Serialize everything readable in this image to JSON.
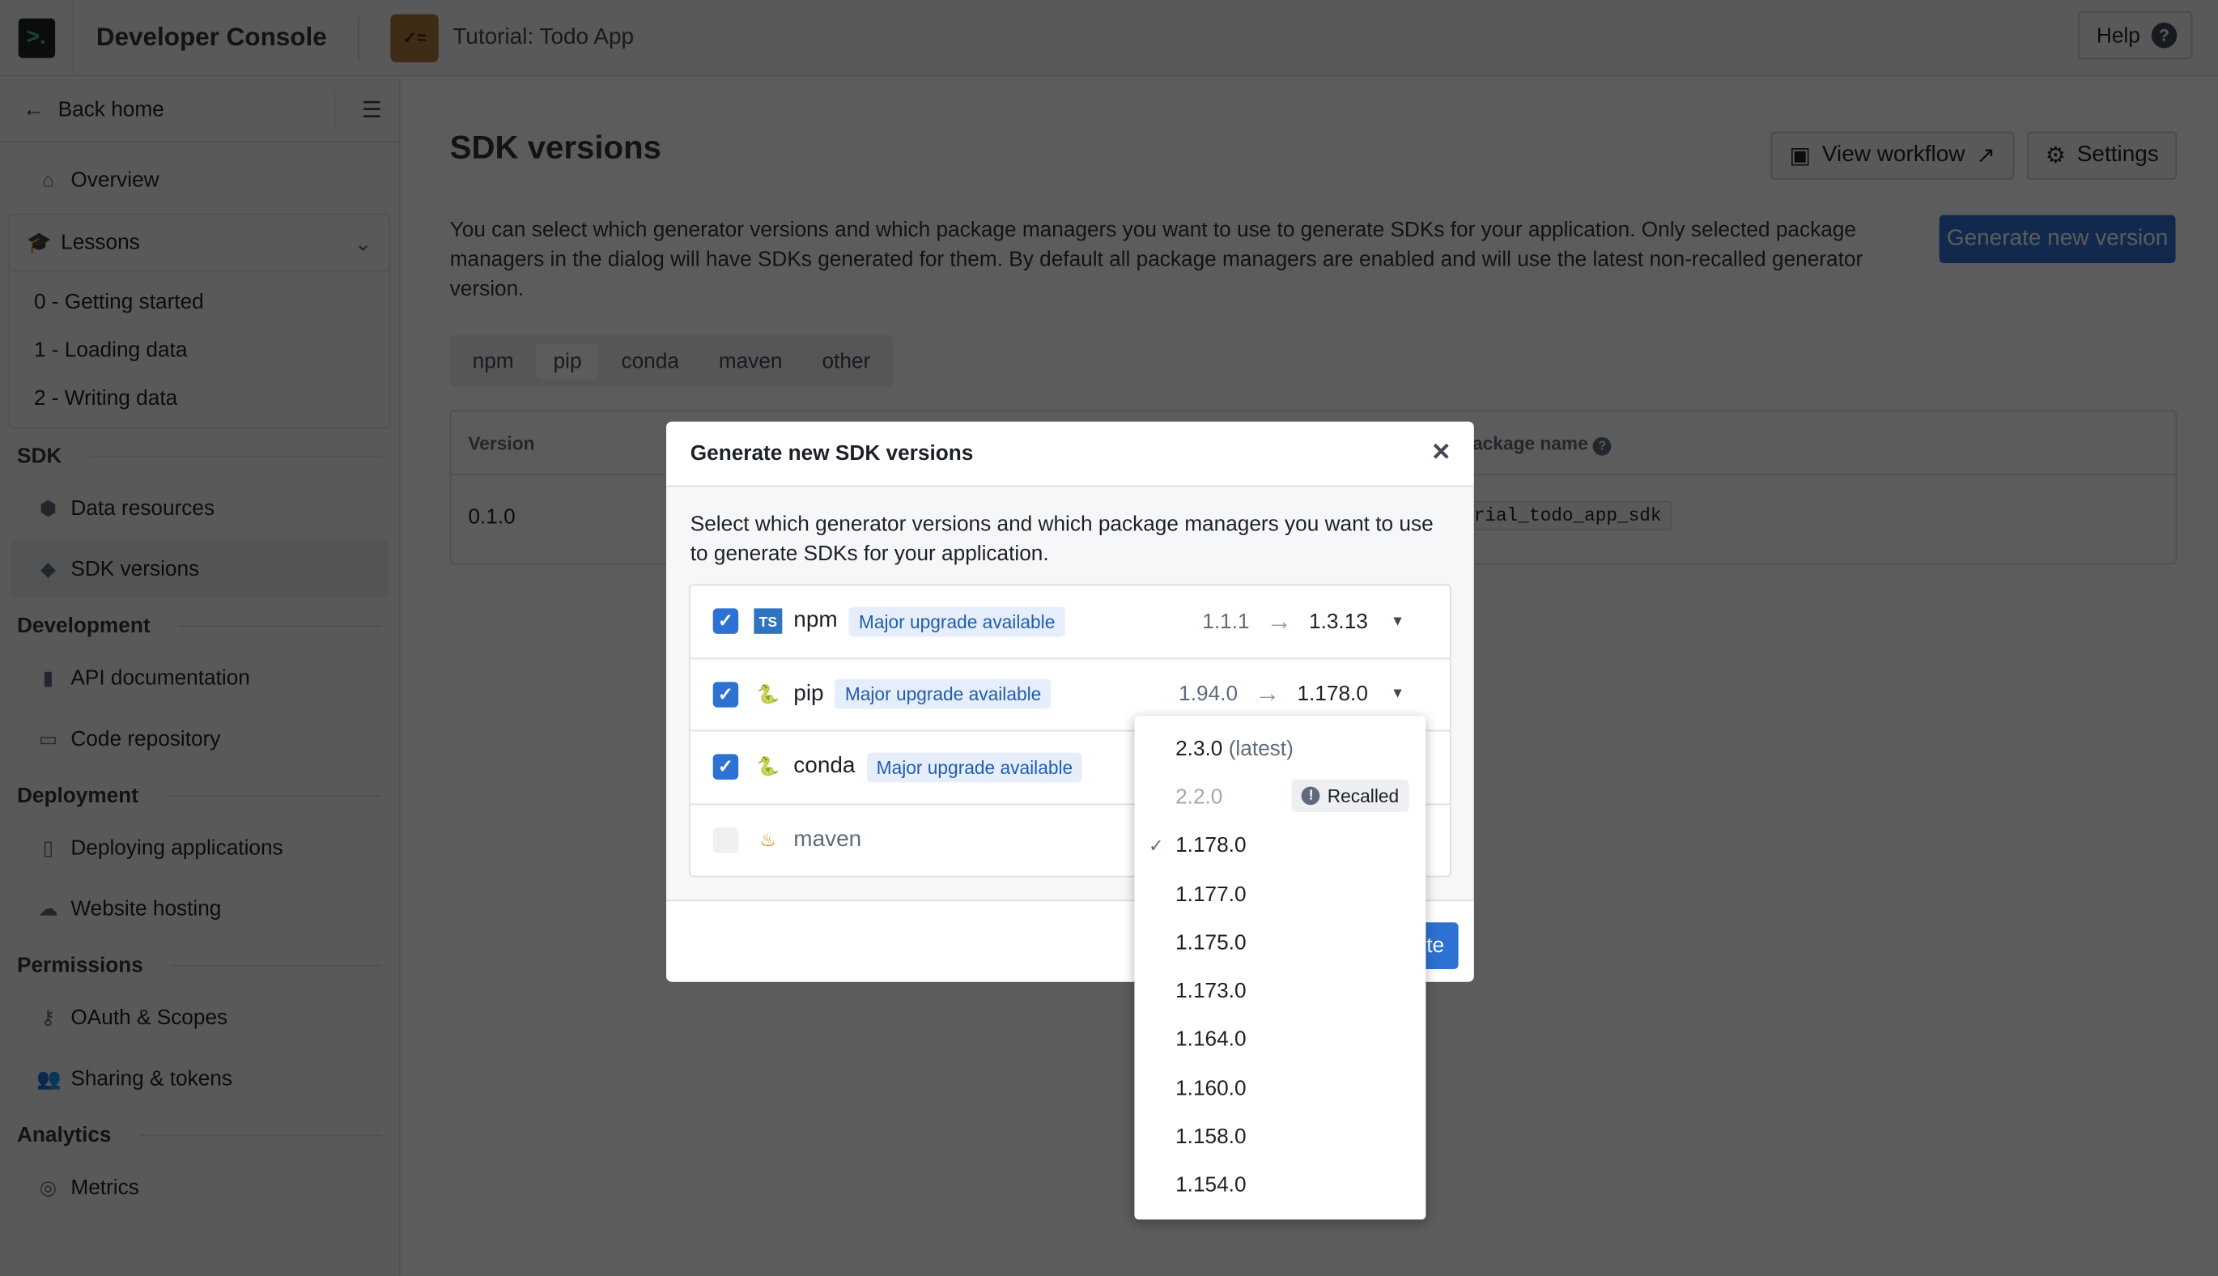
{
  "header": {
    "app_title": "Developer Console",
    "project_title": "Tutorial: Todo App",
    "help_label": "Help"
  },
  "sidebar": {
    "back_label": "Back home",
    "overview": "Overview",
    "lessons": {
      "label": "Lessons",
      "items": [
        "0 - Getting started",
        "1 - Loading data",
        "2 - Writing data"
      ]
    },
    "sections": [
      {
        "title": "SDK",
        "items": [
          {
            "label": "Data resources",
            "icon": "cube-icon"
          },
          {
            "label": "SDK versions",
            "icon": "tag-icon",
            "active": true
          }
        ]
      },
      {
        "title": "Development",
        "items": [
          {
            "label": "API documentation",
            "icon": "book-icon"
          },
          {
            "label": "Code repository",
            "icon": "repo-icon"
          }
        ]
      },
      {
        "title": "Deployment",
        "items": [
          {
            "label": "Deploying applications",
            "icon": "open-book-icon"
          },
          {
            "label": "Website hosting",
            "icon": "cloud-icon"
          }
        ]
      },
      {
        "title": "Permissions",
        "items": [
          {
            "label": "OAuth & Scopes",
            "icon": "key-icon"
          },
          {
            "label": "Sharing & tokens",
            "icon": "people-icon"
          }
        ]
      },
      {
        "title": "Analytics",
        "items": [
          {
            "label": "Metrics",
            "icon": "gauge-icon"
          }
        ]
      }
    ]
  },
  "main": {
    "title": "SDK versions",
    "view_workflow": "View workflow",
    "settings": "Settings",
    "generate_button": "Generate new version",
    "description": "You can select which generator versions and which package managers you want to use to generate SDKs for your application. Only selected package managers in the dialog will have SDKs generated for them. By default all package managers are enabled and will use the latest non-recalled generator version.",
    "tabs": [
      "npm",
      "pip",
      "conda",
      "maven",
      "other"
    ],
    "selected_tab": "pip",
    "table": {
      "headers": [
        "Version",
        "ackage name"
      ],
      "rows": [
        [
          "0.1.0",
          "rial_todo_app_sdk"
        ]
      ]
    }
  },
  "modal": {
    "title": "Generate new SDK versions",
    "description": "Select which generator versions and which package managers you want to use to generate SDKs for your application.",
    "packages": [
      {
        "name": "npm",
        "checked": true,
        "icon": "typescript-icon",
        "badge": "Major upgrade available",
        "from": "1.1.1",
        "to": "1.3.13"
      },
      {
        "name": "pip",
        "checked": true,
        "icon": "python-icon",
        "badge": "Major upgrade available",
        "from": "1.94.0",
        "to": "1.178.0"
      },
      {
        "name": "conda",
        "checked": true,
        "icon": "python-icon",
        "badge": "Major upgrade available"
      },
      {
        "name": "maven",
        "checked": false,
        "icon": "java-icon"
      }
    ],
    "primary_button_partial": "te"
  },
  "dropdown": {
    "options": [
      {
        "label": "2.3.0",
        "suffix": " (latest)"
      },
      {
        "label": "2.2.0",
        "recalled": "Recalled"
      },
      {
        "label": "1.178.0",
        "selected": true
      },
      {
        "label": "1.177.0"
      },
      {
        "label": "1.175.0"
      },
      {
        "label": "1.173.0"
      },
      {
        "label": "1.164.0"
      },
      {
        "label": "1.160.0"
      },
      {
        "label": "1.158.0"
      },
      {
        "label": "1.154.0"
      }
    ]
  },
  "colors": {
    "primary": "#2d72d2",
    "badge_bg": "#e5eefa",
    "badge_text": "#215db0"
  }
}
